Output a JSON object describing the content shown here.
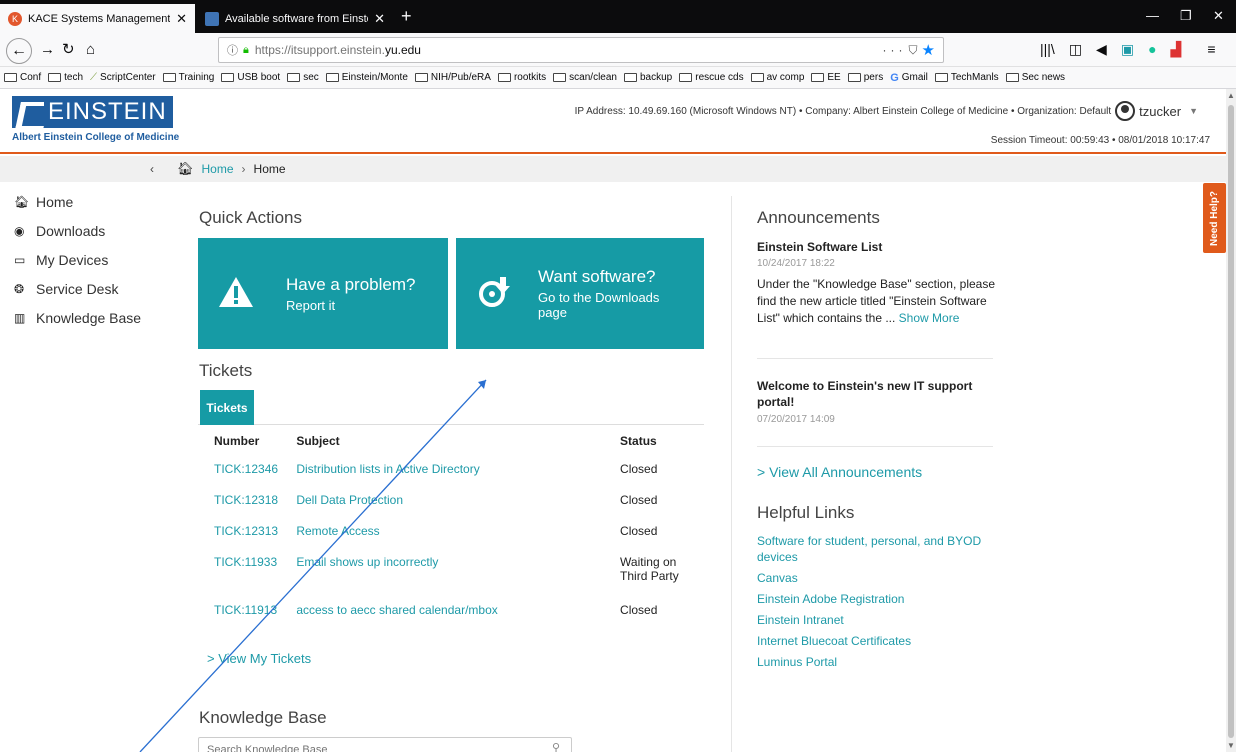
{
  "browser": {
    "tabs": [
      {
        "title": "KACE Systems Management Ap",
        "active": true
      },
      {
        "title": "Available software from Einste",
        "active": false
      }
    ],
    "url_prefix": "https://itsupport.einstein.",
    "url_domain": "yu.edu",
    "url_actions": "···",
    "bookmarks": [
      "Conf",
      "tech",
      "ScriptCenter",
      "Training",
      "USB boot",
      "sec",
      "Einstein/Monte",
      "NIH/Pub/eRA",
      "rootkits",
      "scan/clean",
      "backup",
      "rescue cds",
      "av comp",
      "EE",
      "pers",
      "Gmail",
      "TechManls",
      "Sec news"
    ]
  },
  "header": {
    "logo_word": "EINSTEIN",
    "logo_subtitle": "Albert Einstein College of Medicine",
    "info_line": "IP Address: 10.49.69.160 (Microsoft Windows NT) • Company: Albert Einstein College of Medicine • Organization: Default",
    "username": "tzucker",
    "session": "Session Timeout: 00:59:43 • 08/01/2018 10:17:47"
  },
  "breadcrumb": {
    "first": "Home",
    "second": "Home"
  },
  "sidenav": [
    {
      "label": "Home",
      "icon": "home-icon"
    },
    {
      "label": "Downloads",
      "icon": "download-icon"
    },
    {
      "label": "My Devices",
      "icon": "monitor-icon"
    },
    {
      "label": "Service Desk",
      "icon": "lifesaver-icon"
    },
    {
      "label": "Knowledge Base",
      "icon": "books-icon"
    }
  ],
  "quick_actions": {
    "title": "Quick Actions",
    "problem": {
      "title": "Have a problem?",
      "subtitle": "Report it"
    },
    "software": {
      "title": "Want software?",
      "subtitle": "Go to the Downloads page"
    }
  },
  "tickets": {
    "title": "Tickets",
    "tab_label": "Tickets",
    "columns": [
      "Number",
      "Subject",
      "Status"
    ],
    "rows": [
      {
        "number": "TICK:12346",
        "subject": "Distribution lists in Active Directory",
        "status": "Closed"
      },
      {
        "number": "TICK:12318",
        "subject": "Dell Data Protection",
        "status": "Closed"
      },
      {
        "number": "TICK:12313",
        "subject": "Remote Access",
        "status": "Closed"
      },
      {
        "number": "TICK:11933",
        "subject": "Email shows up incorrectly",
        "status": "Waiting on Third Party"
      },
      {
        "number": "TICK:11913",
        "subject": "access to aecc shared calendar/mbox",
        "status": "Closed"
      }
    ],
    "view_link": "> View My Tickets"
  },
  "knowledge_base": {
    "title": "Knowledge Base",
    "search_placeholder": "Search Knowledge Base"
  },
  "announcements": {
    "title": "Announcements",
    "items": [
      {
        "title": "Einstein Software List",
        "date": "10/24/2017 18:22",
        "body": "Under the \"Knowledge Base\" section, please find the new article titled \"Einstein Software List\" which contains the ...",
        "more": "Show More"
      },
      {
        "title": "Welcome to Einstein's new IT support portal!",
        "date": "07/20/2017 14:09"
      }
    ],
    "view_all": "> View All Announcements"
  },
  "helpful_links": {
    "title": "Helpful Links",
    "links": [
      "Software for student, personal, and BYOD devices",
      "Canvas",
      "Einstein Adobe Registration",
      "Einstein Intranet",
      "Internet Bluecoat Certificates",
      "Luminus Portal"
    ]
  },
  "need_help": "Need Help?",
  "colors": {
    "accent": "#169ba5",
    "brand": "#1f5d9f",
    "orange": "#e05a1b"
  }
}
